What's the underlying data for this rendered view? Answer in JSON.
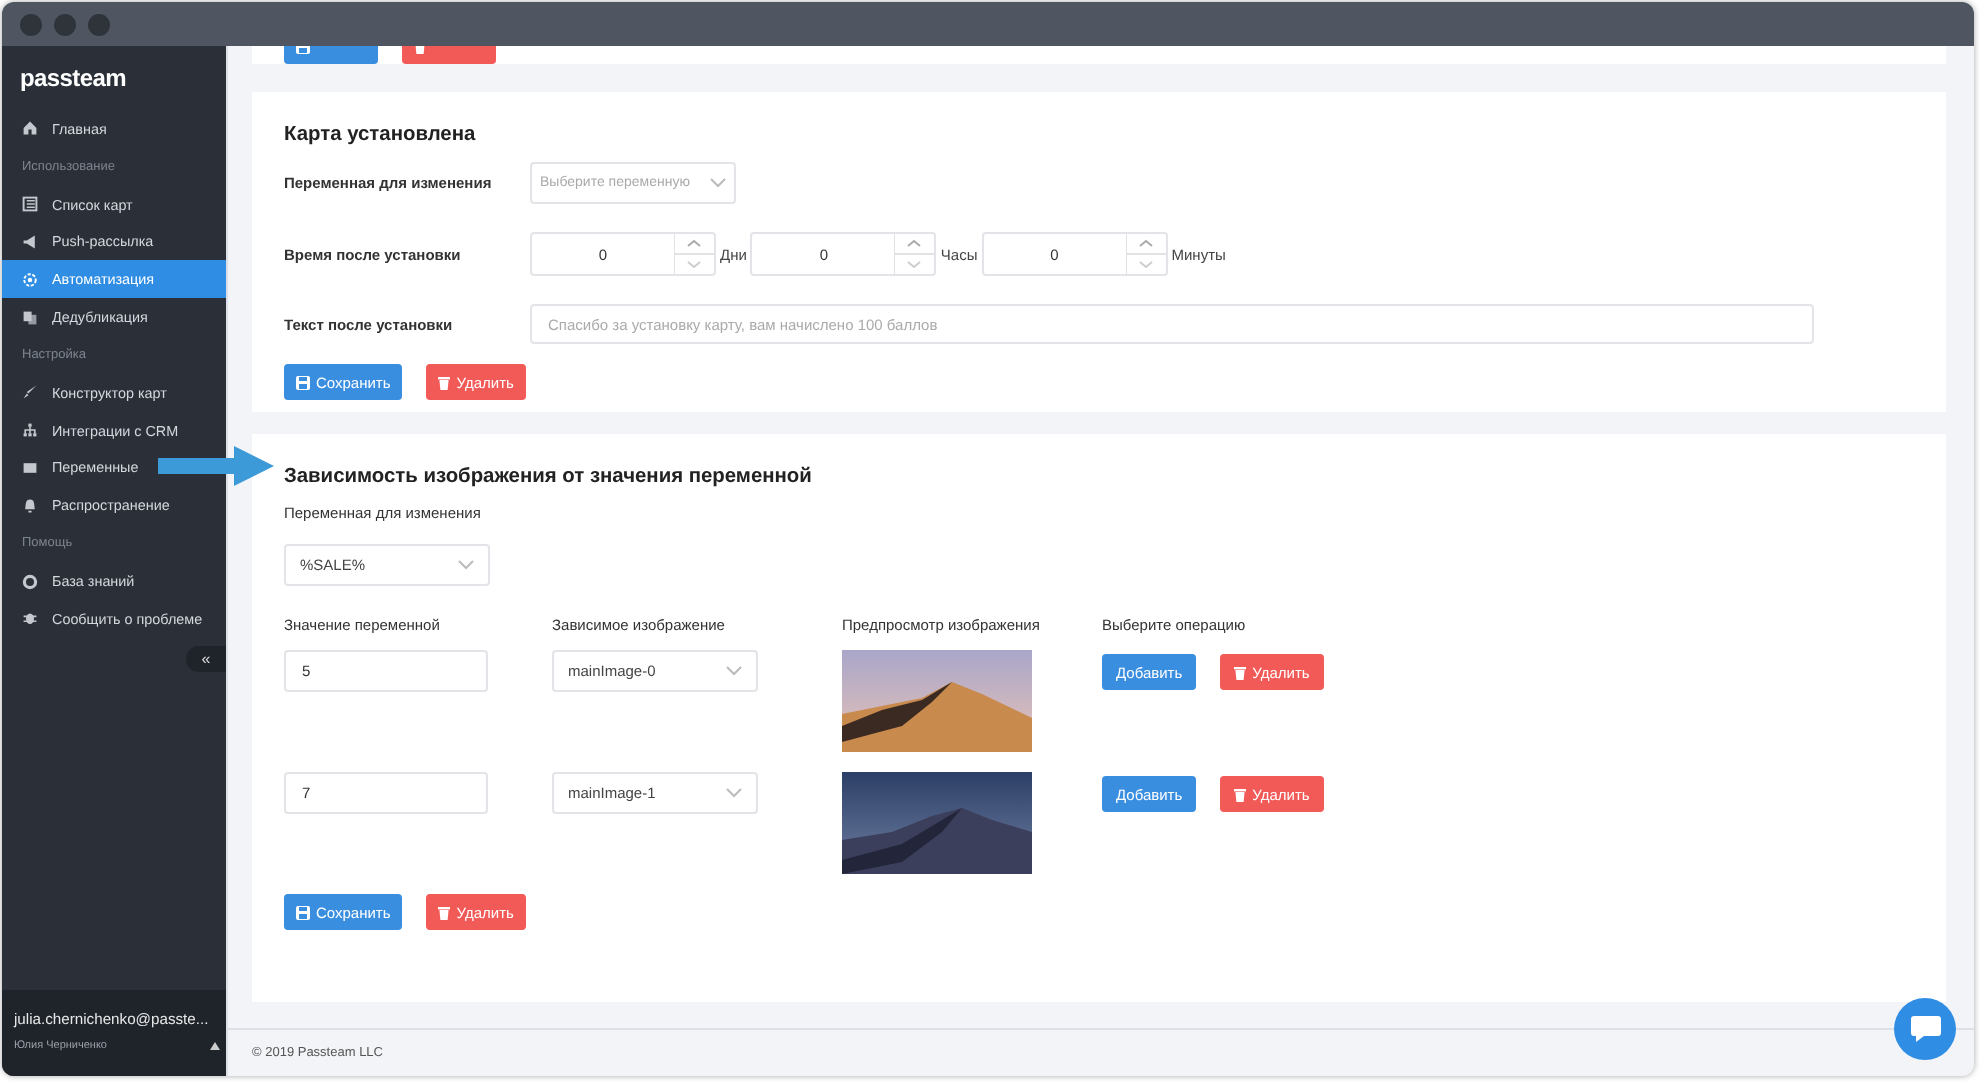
{
  "sidebar": {
    "logo": "passteam",
    "items": [
      {
        "kind": "link",
        "label": "Главная",
        "selected": false
      },
      {
        "kind": "section",
        "label": "Использование"
      },
      {
        "kind": "link",
        "label": "Список карт",
        "selected": false
      },
      {
        "kind": "link",
        "label": "Push-рассылка",
        "selected": false
      },
      {
        "kind": "link",
        "label": "Автоматизация",
        "selected": true
      },
      {
        "kind": "link",
        "label": "Дедубликация",
        "selected": false
      },
      {
        "kind": "section",
        "label": "Настройка"
      },
      {
        "kind": "link",
        "label": "Конструктор карт",
        "selected": false
      },
      {
        "kind": "link",
        "label": "Интеграции с CRM",
        "selected": false
      },
      {
        "kind": "link",
        "label": "Переменные",
        "selected": false
      },
      {
        "kind": "link",
        "label": "Распространение",
        "selected": false
      },
      {
        "kind": "section",
        "label": "Помощь"
      },
      {
        "kind": "link",
        "label": "База знаний",
        "selected": false
      },
      {
        "kind": "link",
        "label": "Сообщить о проблеме",
        "selected": false
      }
    ],
    "collapse_button": "«",
    "user": {
      "email": "julia.chernichenko@passte...",
      "name": "Юлия Черниченко"
    }
  },
  "partial_card": {
    "buttons": [
      {
        "kind": "save"
      },
      {
        "kind": "delete"
      }
    ]
  },
  "card_installed": {
    "title": "Карта установлена",
    "fields": [
      {
        "kind": "select",
        "label": "Переменная для изменения",
        "placeholder": "Выберите переменную"
      },
      {
        "kind": "duration",
        "label": "Время после установки",
        "parts": [
          {
            "value": "0",
            "unit": "Дни"
          },
          {
            "value": "0",
            "unit": "Часы"
          },
          {
            "value": "0",
            "unit": "Минуты"
          }
        ]
      },
      {
        "kind": "text",
        "label": "Текст после установки",
        "placeholder": "Спасибо за установку карту, вам начислено 100 баллов"
      }
    ],
    "buttons": [
      {
        "kind": "save",
        "label": "Сохранить"
      },
      {
        "kind": "delete",
        "label": "Удалить"
      }
    ]
  },
  "card_image": {
    "title": "Зависимость изображения от значения переменной",
    "variable_label": "Переменная для изменения",
    "variable_value": "%SALE%",
    "columns": [
      "Значение переменной",
      "Зависимое изображение",
      "Предпросмотр изображения",
      "Выберите операцию"
    ],
    "rows": [
      {
        "value": "5",
        "image": "mainImage-0",
        "buttons": [
          {
            "kind": "add",
            "label": "Добавить"
          },
          {
            "kind": "delete",
            "label": "Удалить"
          }
        ]
      },
      {
        "value": "7",
        "image": "mainImage-1",
        "buttons": [
          {
            "kind": "add",
            "label": "Добавить"
          },
          {
            "kind": "delete",
            "label": "Удалить"
          }
        ]
      }
    ],
    "buttons": [
      {
        "kind": "save",
        "label": "Сохранить"
      },
      {
        "kind": "delete",
        "label": "Удалить"
      }
    ]
  },
  "footer": "© 2019 Passteam LLC"
}
